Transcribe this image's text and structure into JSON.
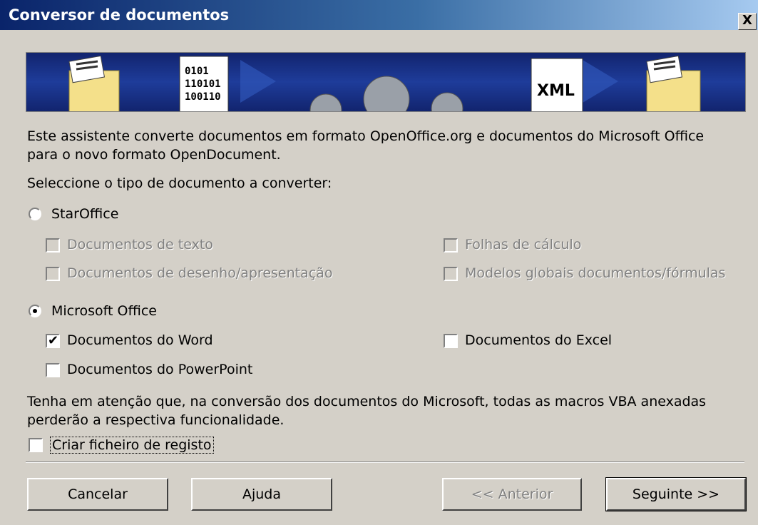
{
  "window": {
    "title": "Conversor de documentos",
    "close_label": "X"
  },
  "banner": {
    "binary_text": [
      "0101",
      "110101",
      "100110"
    ],
    "xml_text": "XML"
  },
  "intro": {
    "line1": "Este assistente converte documentos em formato OpenOffice.org e documentos do Microsoft Office",
    "line2": "para o novo formato OpenDocument."
  },
  "select_prompt": "Seleccione o tipo de documento a converter:",
  "staroffice": {
    "label": "StarOffice",
    "selected": false,
    "options": [
      {
        "label": "Documentos de texto",
        "checked": false,
        "enabled": false
      },
      {
        "label": "Folhas de cálculo",
        "checked": false,
        "enabled": false
      },
      {
        "label": "Documentos de desenho/apresentação",
        "checked": false,
        "enabled": false
      },
      {
        "label": "Modelos globais documentos/fórmulas",
        "checked": false,
        "enabled": false
      }
    ]
  },
  "msoffice": {
    "label": "Microsoft Office",
    "selected": true,
    "options": [
      {
        "label": "Documentos do Word",
        "checked": true,
        "enabled": true
      },
      {
        "label": "Documentos do Excel",
        "checked": false,
        "enabled": true
      },
      {
        "label": "Documentos do PowerPoint",
        "checked": false,
        "enabled": true
      }
    ]
  },
  "note": {
    "line1": "Tenha em atenção que, na conversão dos documentos do Microsoft, todas as macros VBA anexadas",
    "line2": "perderão a respectiva funcionalidade."
  },
  "log_option": {
    "label": "Criar ficheiro de registo",
    "checked": false
  },
  "buttons": {
    "cancel": "Cancelar",
    "help": "Ajuda",
    "back": "<< Anterior",
    "next": "Seguinte >>"
  }
}
